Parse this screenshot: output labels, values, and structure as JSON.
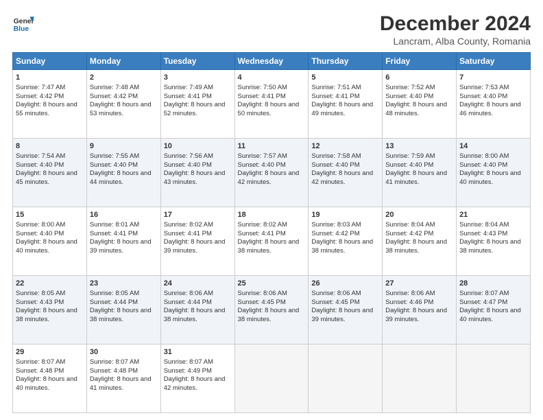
{
  "logo": {
    "line1": "General",
    "line2": "Blue"
  },
  "title": "December 2024",
  "subtitle": "Lancram, Alba County, Romania",
  "days_of_week": [
    "Sunday",
    "Monday",
    "Tuesday",
    "Wednesday",
    "Thursday",
    "Friday",
    "Saturday"
  ],
  "weeks": [
    [
      {
        "day": 1,
        "sunrise": "7:47 AM",
        "sunset": "4:42 PM",
        "daylight": "8 hours and 55 minutes."
      },
      {
        "day": 2,
        "sunrise": "7:48 AM",
        "sunset": "4:42 PM",
        "daylight": "8 hours and 53 minutes."
      },
      {
        "day": 3,
        "sunrise": "7:49 AM",
        "sunset": "4:41 PM",
        "daylight": "8 hours and 52 minutes."
      },
      {
        "day": 4,
        "sunrise": "7:50 AM",
        "sunset": "4:41 PM",
        "daylight": "8 hours and 50 minutes."
      },
      {
        "day": 5,
        "sunrise": "7:51 AM",
        "sunset": "4:41 PM",
        "daylight": "8 hours and 49 minutes."
      },
      {
        "day": 6,
        "sunrise": "7:52 AM",
        "sunset": "4:40 PM",
        "daylight": "8 hours and 48 minutes."
      },
      {
        "day": 7,
        "sunrise": "7:53 AM",
        "sunset": "4:40 PM",
        "daylight": "8 hours and 46 minutes."
      }
    ],
    [
      {
        "day": 8,
        "sunrise": "7:54 AM",
        "sunset": "4:40 PM",
        "daylight": "8 hours and 45 minutes."
      },
      {
        "day": 9,
        "sunrise": "7:55 AM",
        "sunset": "4:40 PM",
        "daylight": "8 hours and 44 minutes."
      },
      {
        "day": 10,
        "sunrise": "7:56 AM",
        "sunset": "4:40 PM",
        "daylight": "8 hours and 43 minutes."
      },
      {
        "day": 11,
        "sunrise": "7:57 AM",
        "sunset": "4:40 PM",
        "daylight": "8 hours and 42 minutes."
      },
      {
        "day": 12,
        "sunrise": "7:58 AM",
        "sunset": "4:40 PM",
        "daylight": "8 hours and 42 minutes."
      },
      {
        "day": 13,
        "sunrise": "7:59 AM",
        "sunset": "4:40 PM",
        "daylight": "8 hours and 41 minutes."
      },
      {
        "day": 14,
        "sunrise": "8:00 AM",
        "sunset": "4:40 PM",
        "daylight": "8 hours and 40 minutes."
      }
    ],
    [
      {
        "day": 15,
        "sunrise": "8:00 AM",
        "sunset": "4:40 PM",
        "daylight": "8 hours and 40 minutes."
      },
      {
        "day": 16,
        "sunrise": "8:01 AM",
        "sunset": "4:41 PM",
        "daylight": "8 hours and 39 minutes."
      },
      {
        "day": 17,
        "sunrise": "8:02 AM",
        "sunset": "4:41 PM",
        "daylight": "8 hours and 39 minutes."
      },
      {
        "day": 18,
        "sunrise": "8:02 AM",
        "sunset": "4:41 PM",
        "daylight": "8 hours and 38 minutes."
      },
      {
        "day": 19,
        "sunrise": "8:03 AM",
        "sunset": "4:42 PM",
        "daylight": "8 hours and 38 minutes."
      },
      {
        "day": 20,
        "sunrise": "8:04 AM",
        "sunset": "4:42 PM",
        "daylight": "8 hours and 38 minutes."
      },
      {
        "day": 21,
        "sunrise": "8:04 AM",
        "sunset": "4:43 PM",
        "daylight": "8 hours and 38 minutes."
      }
    ],
    [
      {
        "day": 22,
        "sunrise": "8:05 AM",
        "sunset": "4:43 PM",
        "daylight": "8 hours and 38 minutes."
      },
      {
        "day": 23,
        "sunrise": "8:05 AM",
        "sunset": "4:44 PM",
        "daylight": "8 hours and 38 minutes."
      },
      {
        "day": 24,
        "sunrise": "8:06 AM",
        "sunset": "4:44 PM",
        "daylight": "8 hours and 38 minutes."
      },
      {
        "day": 25,
        "sunrise": "8:06 AM",
        "sunset": "4:45 PM",
        "daylight": "8 hours and 38 minutes."
      },
      {
        "day": 26,
        "sunrise": "8:06 AM",
        "sunset": "4:45 PM",
        "daylight": "8 hours and 39 minutes."
      },
      {
        "day": 27,
        "sunrise": "8:06 AM",
        "sunset": "4:46 PM",
        "daylight": "8 hours and 39 minutes."
      },
      {
        "day": 28,
        "sunrise": "8:07 AM",
        "sunset": "4:47 PM",
        "daylight": "8 hours and 40 minutes."
      }
    ],
    [
      {
        "day": 29,
        "sunrise": "8:07 AM",
        "sunset": "4:48 PM",
        "daylight": "8 hours and 40 minutes."
      },
      {
        "day": 30,
        "sunrise": "8:07 AM",
        "sunset": "4:48 PM",
        "daylight": "8 hours and 41 minutes."
      },
      {
        "day": 31,
        "sunrise": "8:07 AM",
        "sunset": "4:49 PM",
        "daylight": "8 hours and 42 minutes."
      },
      null,
      null,
      null,
      null
    ]
  ]
}
